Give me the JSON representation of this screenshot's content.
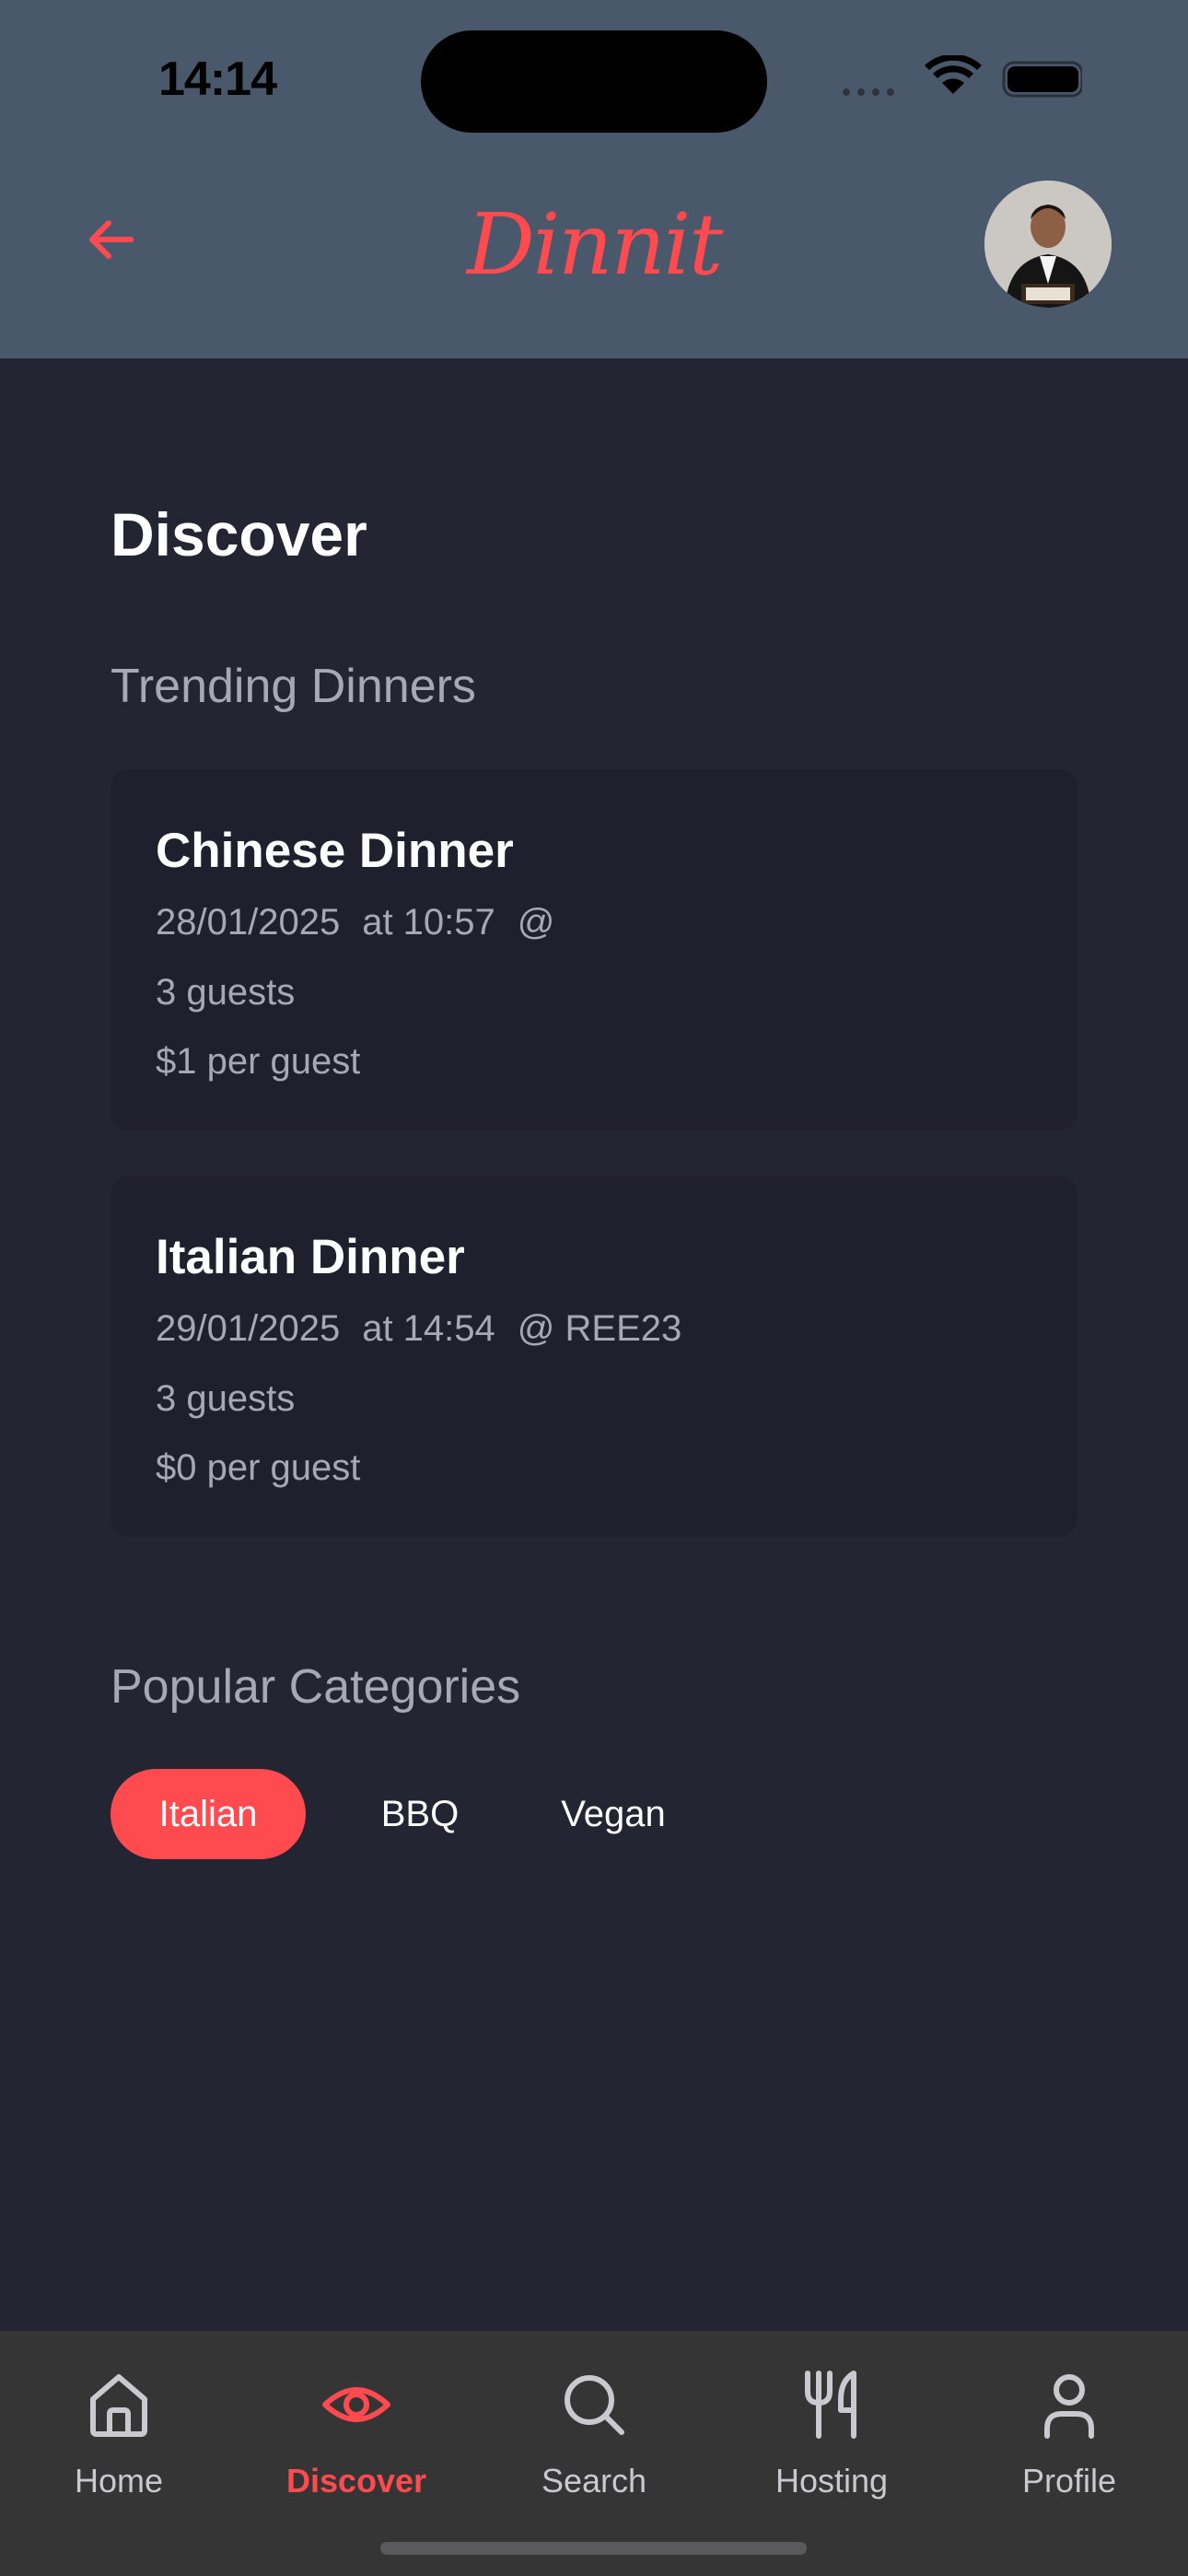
{
  "status_bar": {
    "time": "14:14"
  },
  "header": {
    "logo": "Dinnit"
  },
  "page": {
    "title": "Discover"
  },
  "trending": {
    "heading": "Trending Dinners",
    "cards": [
      {
        "title": "Chinese Dinner",
        "date": "28/01/2025",
        "time": "at 10:57",
        "location": "@",
        "guests": "3 guests",
        "price": "$1 per guest"
      },
      {
        "title": "Italian Dinner",
        "date": "29/01/2025",
        "time": "at 14:54",
        "location": "@ REE23",
        "guests": "3 guests",
        "price": "$0 per guest"
      }
    ]
  },
  "categories": {
    "heading": "Popular Categories",
    "items": [
      {
        "label": "Italian",
        "selected": true
      },
      {
        "label": "BBQ",
        "selected": false
      },
      {
        "label": "Vegan",
        "selected": false
      }
    ]
  },
  "tabbar": {
    "items": [
      {
        "label": "Home",
        "icon": "home-icon"
      },
      {
        "label": "Discover",
        "icon": "eye-icon",
        "active": true
      },
      {
        "label": "Search",
        "icon": "search-icon"
      },
      {
        "label": "Hosting",
        "icon": "utensils-icon"
      },
      {
        "label": "Profile",
        "icon": "person-icon"
      }
    ]
  },
  "colors": {
    "accent": "#ff4a4f",
    "header_bg": "#4a586c",
    "page_bg": "#232532",
    "card_bg": "#1f1f2d",
    "tabbar_bg": "#353535"
  }
}
